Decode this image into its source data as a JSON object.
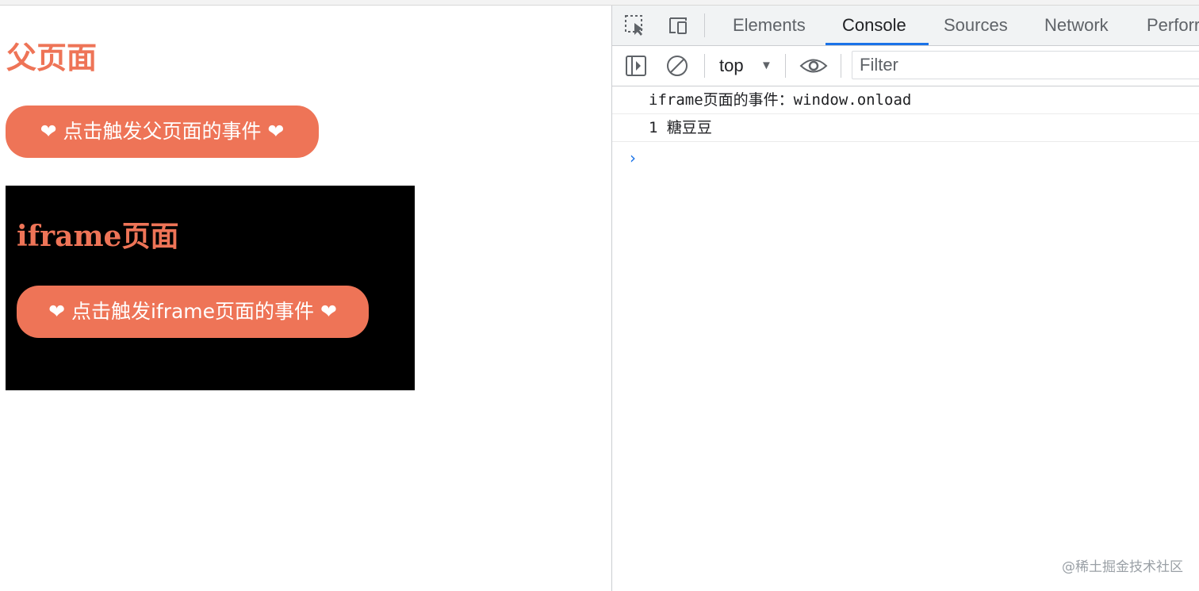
{
  "parent_page": {
    "title": "父页面",
    "button_label": "❤ 点击触发父页面的事件 ❤"
  },
  "iframe_page": {
    "title": "iframe页面",
    "button_label": "❤ 点击触发iframe页面的事件 ❤"
  },
  "devtools": {
    "tabs": [
      {
        "label": "Elements",
        "active": false
      },
      {
        "label": "Console",
        "active": true
      },
      {
        "label": "Sources",
        "active": false
      },
      {
        "label": "Network",
        "active": false
      },
      {
        "label": "Perforr",
        "active": false
      }
    ],
    "toolbar": {
      "context": "top",
      "filter_placeholder": "Filter"
    },
    "console": {
      "lines": [
        "iframe页面的事件：window.onload",
        "1 糖豆豆"
      ],
      "prompt": "›"
    },
    "icons": {
      "inspect": "inspect-element-icon",
      "device": "device-toggle-icon",
      "sidebar": "sidebar-toggle-icon",
      "clear": "clear-console-icon",
      "live_expression": "eye-icon",
      "dropdown": "caret-down-icon"
    }
  },
  "watermark": "@稀土掘金技术社区",
  "colors": {
    "accent": "#ee7457",
    "iframe_bg": "#000000",
    "tab_underline": "#1a73e8",
    "prompt": "#1a73e8"
  }
}
